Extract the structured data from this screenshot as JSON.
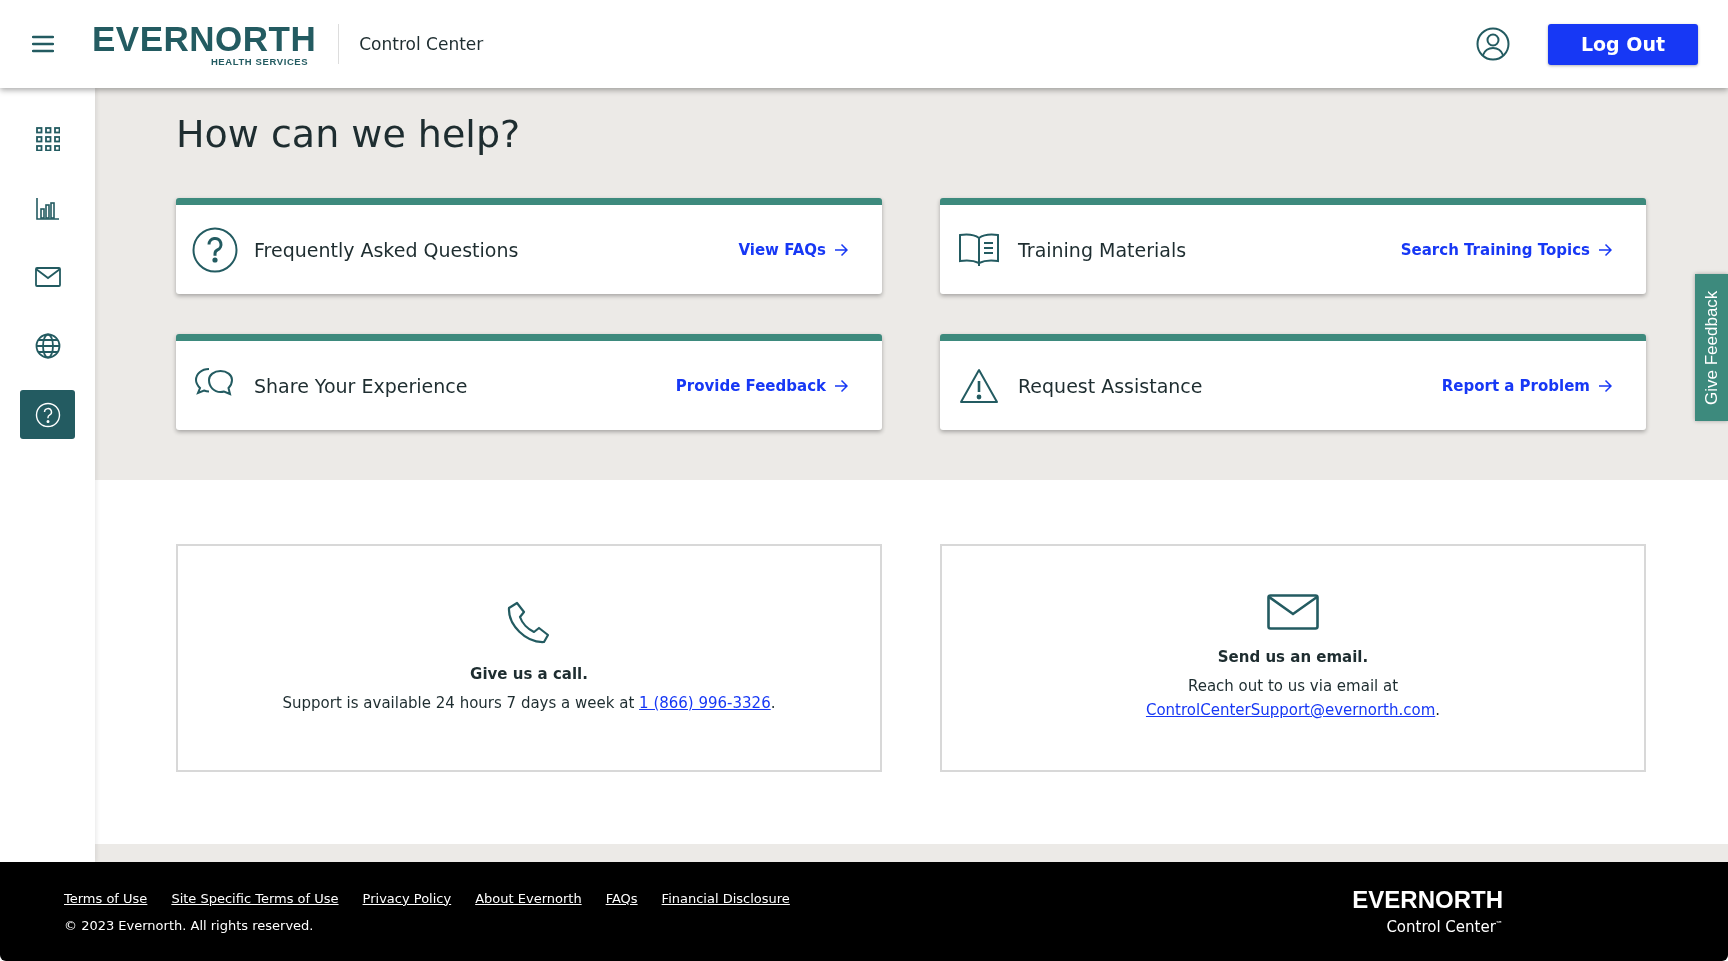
{
  "header": {
    "logo": {
      "wordmark": "EVERNORTH",
      "tagline": "HEALTH SERVICES"
    },
    "app_name": "Control Center",
    "logout_button": "Log Out"
  },
  "sidebar": {
    "items": [
      {
        "kind": "apps",
        "selected": false
      },
      {
        "kind": "chart",
        "selected": false
      },
      {
        "kind": "mail",
        "selected": false
      },
      {
        "kind": "globe",
        "selected": false
      },
      {
        "kind": "help",
        "selected": true
      }
    ]
  },
  "page_title": "How can we help?",
  "help_cards": [
    {
      "kind": "question",
      "title": "Frequently Asked Questions",
      "link": "View FAQs"
    },
    {
      "kind": "book",
      "title": "Training Materials",
      "link": "Search Training Topics"
    },
    {
      "kind": "chat",
      "title": "Share Your Experience",
      "link": "Provide Feedback"
    },
    {
      "kind": "warning",
      "title": "Request Assistance",
      "link": "Report a Problem"
    }
  ],
  "contact_cards": [
    {
      "kind": "phone",
      "heading": "Give us a call.",
      "text": "Support is available 24 hours 7 days a week at",
      "link": "1 (866) 996-3326",
      "suffix": "."
    },
    {
      "kind": "email",
      "heading": "Send us an email.",
      "text": "Reach out to us via email at",
      "link": "ControlCenterSupport@evernorth.com",
      "suffix": "."
    }
  ],
  "feedback_tab": "Give Feedback",
  "footer": {
    "links": [
      "Terms of Use",
      "Site Specific Terms of Use",
      "Privacy Policy",
      "About Evernorth",
      "FAQs",
      "Financial Disclosure"
    ],
    "copyright": "© 2023 Evernorth. All rights reserved.",
    "logo": {
      "wordmark": "EVERNORTH",
      "product": "Control Center$^{℠}$"
    }
  }
}
